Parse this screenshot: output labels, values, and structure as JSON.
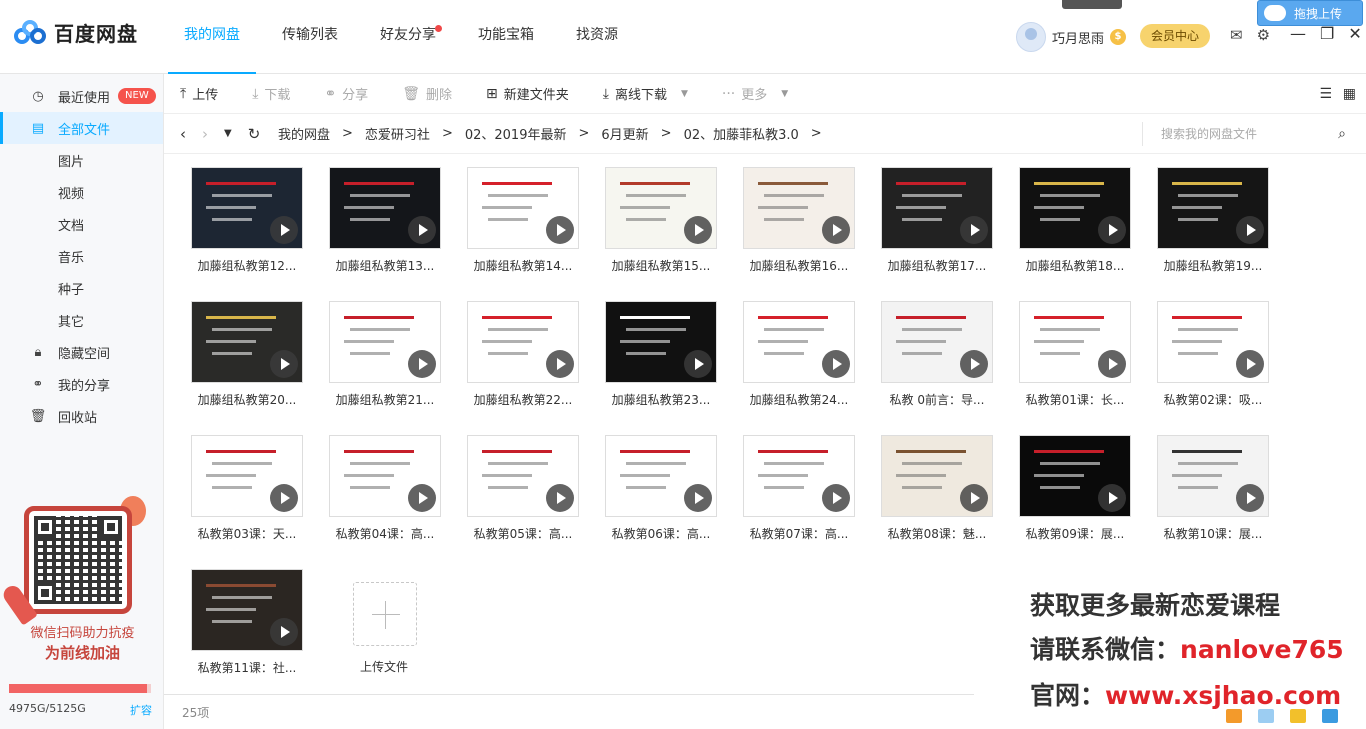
{
  "app": {
    "name": "百度网盘"
  },
  "nav": [
    {
      "label": "我的网盘",
      "active": true
    },
    {
      "label": "传输列表"
    },
    {
      "label": "好友分享",
      "dot": true
    },
    {
      "label": "功能宝箱"
    },
    {
      "label": "找资源"
    }
  ],
  "user": {
    "name": "巧月思雨",
    "vip_label": "会员中心"
  },
  "drag_upload": {
    "label": "拖拽上传"
  },
  "sidebar": {
    "items": [
      {
        "label": "最近使用",
        "badge": "NEW",
        "icon": "clock-icon"
      },
      {
        "label": "全部文件",
        "icon": "file-icon",
        "active": true
      },
      {
        "label": "图片"
      },
      {
        "label": "视频"
      },
      {
        "label": "文档"
      },
      {
        "label": "音乐"
      },
      {
        "label": "种子"
      },
      {
        "label": "其它"
      },
      {
        "label": "隐藏空间",
        "icon": "lock-icon"
      },
      {
        "label": "我的分享",
        "icon": "share-icon"
      },
      {
        "label": "回收站",
        "icon": "trash-icon"
      }
    ],
    "promo": {
      "line1": "微信扫码助力抗疫",
      "line2": "为前线加油"
    },
    "quota": {
      "text": "4975G/5125G",
      "expand": "扩容",
      "used_fraction": 0.97
    }
  },
  "toolbar": {
    "upload": "上传",
    "download": "下载",
    "share": "分享",
    "delete": "删除",
    "new_folder": "新建文件夹",
    "offline": "离线下载",
    "more": "更多"
  },
  "breadcrumb": [
    "我的网盘",
    "恋爱研习社",
    "02、2019年最新",
    "6月更新",
    "02、加藤菲私教3.0"
  ],
  "search": {
    "placeholder": "搜索我的网盘文件"
  },
  "files": [
    {
      "name": "加藤组私教第12..."
    },
    {
      "name": "加藤组私教第13..."
    },
    {
      "name": "加藤组私教第14..."
    },
    {
      "name": "加藤组私教第15..."
    },
    {
      "name": "加藤组私教第16..."
    },
    {
      "name": "加藤组私教第17..."
    },
    {
      "name": "加藤组私教第18..."
    },
    {
      "name": "加藤组私教第19..."
    },
    {
      "name": "加藤组私教第20..."
    },
    {
      "name": "加藤组私教第21..."
    },
    {
      "name": "加藤组私教第22..."
    },
    {
      "name": "加藤组私教第23..."
    },
    {
      "name": "加藤组私教第24..."
    },
    {
      "name": "私教 0前言：导..."
    },
    {
      "name": "私教第01课：长..."
    },
    {
      "name": "私教第02课：吸..."
    },
    {
      "name": "私教第03课：天..."
    },
    {
      "name": "私教第04课：高..."
    },
    {
      "name": "私教第05课：高..."
    },
    {
      "name": "私教第06课：高..."
    },
    {
      "name": "私教第07课：高..."
    },
    {
      "name": "私教第08课：魅..."
    },
    {
      "name": "私教第09课：展..."
    },
    {
      "name": "私教第10课：展..."
    },
    {
      "name": "私教第11课：社..."
    }
  ],
  "upload_tile": {
    "label": "上传文件"
  },
  "count": "25项",
  "watermark": {
    "line1": "获取更多最新恋爱课程",
    "line2_prefix": "请联系微信：",
    "line2_value": "nanlove765",
    "line3_prefix": "官网：",
    "line3_value": "www.xsjhao.com"
  },
  "colors": {
    "accent": "#09aaff",
    "danger": "#f5534c",
    "watermark_red": "#e0242a"
  }
}
